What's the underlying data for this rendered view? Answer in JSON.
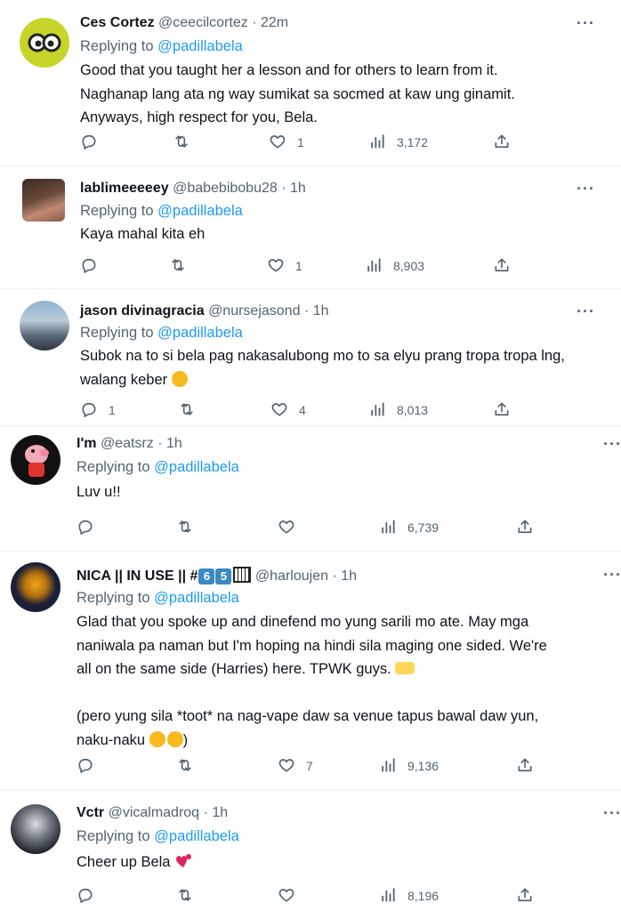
{
  "tweets": [
    {
      "name": "Ces Cortez",
      "handle": "@ceecilcortez",
      "time": "22m",
      "replying_label": "Replying to",
      "replying_handle": "@padillabela",
      "lines": [
        "Good that you taught her a lesson and for others to learn from it.",
        "Naghanap lang ata ng way sumikat sa socmed at kaw ung ginamit.",
        "Anyways, high respect for you, Bela."
      ],
      "reply_count": "",
      "retweet_count": "",
      "like_count": "1",
      "view_count": "3,172"
    },
    {
      "name": "lablimeeeeey",
      "handle": "@babebibobu28",
      "time": "1h",
      "replying_label": "Replying to",
      "replying_handle": "@padillabela",
      "lines": [
        "Kaya mahal kita eh"
      ],
      "reply_count": "",
      "retweet_count": "",
      "like_count": "1",
      "view_count": "8,903"
    },
    {
      "name": "jason divinagracia",
      "handle": "@nursejasond",
      "time": "1h",
      "replying_label": "Replying to",
      "replying_handle": "@padillabela",
      "lines": [
        "Subok na to si bela pag nakasalubong mo to sa elyu prang tropa tropa lng,",
        "walang keber"
      ],
      "reply_count": "1",
      "retweet_count": "",
      "like_count": "4",
      "view_count": "8,013"
    },
    {
      "name": "I'm",
      "handle": "@eatsrz",
      "time": "1h",
      "replying_label": "Replying to",
      "replying_handle": "@padillabela",
      "lines": [
        "Luv u!!"
      ],
      "reply_count": "",
      "retweet_count": "",
      "like_count": "",
      "view_count": "6,739"
    },
    {
      "name": "NICA || IN USE || #",
      "name_badges": [
        "6",
        "5"
      ],
      "handle": "@harloujen",
      "time": "1h",
      "replying_label": "Replying to",
      "replying_handle": "@padillabela",
      "lines": [
        "Glad that you spoke up and dinefend mo yung sarili mo ate. May mga",
        "naniwala pa naman but I'm hoping na hindi sila maging one sided. We're",
        "all on the same side (Harries) here. TPWK guys.",
        "",
        "(pero yung sila *toot* na nag-vape daw sa venue tapus bawal daw yun,",
        "naku-naku"
      ],
      "reply_count": "",
      "retweet_count": "",
      "like_count": "7",
      "view_count": "9,136"
    },
    {
      "name": "Vctr",
      "handle": "@vicalmadroq",
      "time": "1h",
      "replying_label": "Replying to",
      "replying_handle": "@padillabela",
      "lines": [
        "Cheer up Bela"
      ],
      "reply_count": "",
      "retweet_count": "",
      "like_count": "",
      "view_count": "8,196"
    }
  ],
  "separator_dot": "·",
  "more_label": "···",
  "closing_paren": ")",
  "colors": {
    "link": "#1d9bf0",
    "muted": "#536471",
    "text": "#0f1419",
    "divider": "#eff3f4"
  },
  "icons": [
    "reply-icon",
    "retweet-icon",
    "like-icon",
    "views-icon",
    "share-icon",
    "more-icon"
  ]
}
